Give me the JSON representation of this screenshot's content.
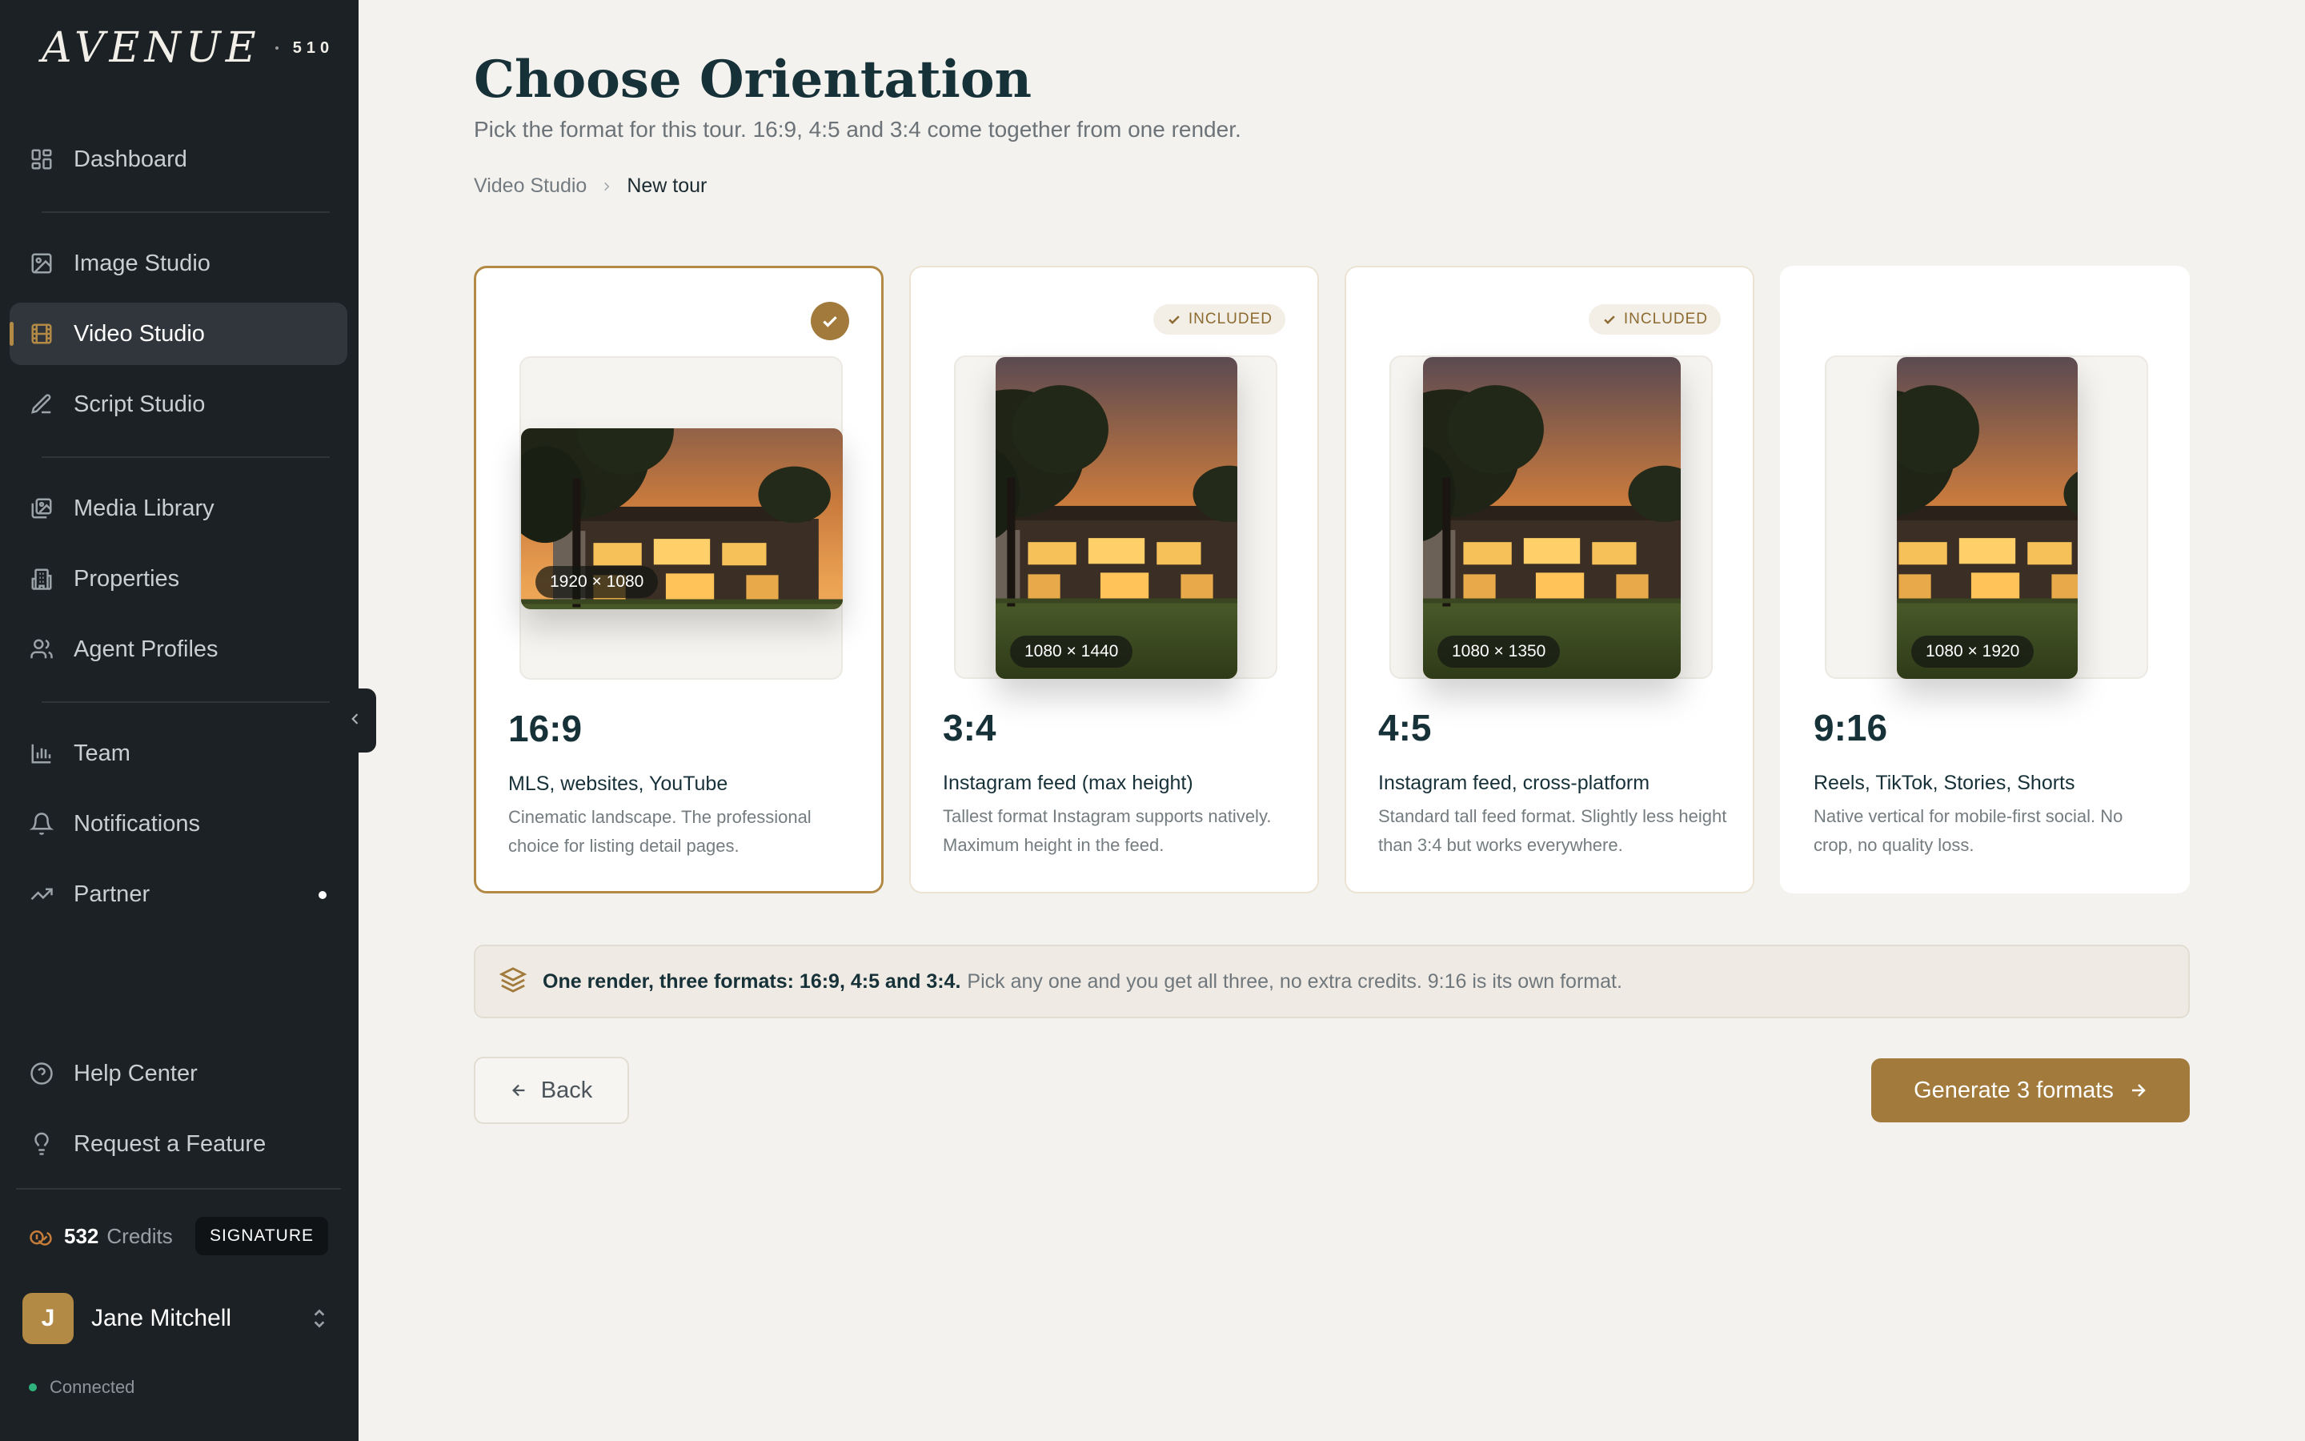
{
  "brand": {
    "name": "AVENUE",
    "number": "510"
  },
  "sidebar": {
    "items": [
      {
        "label": "Dashboard",
        "icon": "grid-icon"
      },
      {
        "label": "Image Studio",
        "icon": "image-icon"
      },
      {
        "label": "Video Studio",
        "icon": "film-icon",
        "active": true
      },
      {
        "label": "Script Studio",
        "icon": "pen-icon"
      },
      {
        "label": "Media Library",
        "icon": "media-library-icon"
      },
      {
        "label": "Properties",
        "icon": "building-icon"
      },
      {
        "label": "Agent Profiles",
        "icon": "users-icon"
      },
      {
        "label": "Team",
        "icon": "bar-chart-icon"
      },
      {
        "label": "Notifications",
        "icon": "bell-icon"
      },
      {
        "label": "Partner",
        "icon": "trending-up-icon"
      },
      {
        "label": "Help Center",
        "icon": "help-circle-icon"
      },
      {
        "label": "Request a Feature",
        "icon": "lightbulb-icon"
      }
    ],
    "credits": {
      "value": "532",
      "label": "Credits",
      "plan": "SIGNATURE"
    },
    "user": {
      "initial": "J",
      "name": "Jane Mitchell"
    },
    "status": "Connected"
  },
  "header": {
    "title": "Choose Orientation",
    "subtitle": "Pick the format for this tour. 16:9, 4:5 and 3:4 come together from one render.",
    "breadcrumb": [
      "Video Studio",
      "New tour"
    ]
  },
  "cards": [
    {
      "ratio": "16:9",
      "dims": "1920 × 1080",
      "title": "MLS, websites, YouTube",
      "desc": "Cinematic landscape. The professional choice for listing detail pages.",
      "state": "selected"
    },
    {
      "ratio": "3:4",
      "dims": "1080 × 1440",
      "title": "Instagram feed (max height)",
      "desc": "Tallest format Instagram supports natively. Maximum height in the feed.",
      "state": "included",
      "badge": "INCLUDED"
    },
    {
      "ratio": "4:5",
      "dims": "1080 × 1350",
      "title": "Instagram feed, cross-platform",
      "desc": "Standard tall feed format. Slightly less height than 3:4 but works everywhere.",
      "state": "included",
      "badge": "INCLUDED"
    },
    {
      "ratio": "9:16",
      "dims": "1080 × 1920",
      "title": "Reels, TikTok, Stories, Shorts",
      "desc": "Native vertical for mobile-first social. No crop, no quality loss.",
      "state": "none"
    }
  ],
  "info": {
    "strong": "One render, three formats: 16:9, 4:5 and 3:4.",
    "rest": "Pick any one and you get all three, no extra credits. 9:16 is its own format."
  },
  "actions": {
    "back": "Back",
    "generate": "Generate 3 formats"
  },
  "colors": {
    "accent": "#a27a3c",
    "sidebar": "#1c2125",
    "background": "#f4f2ee",
    "status": "#2fb37d"
  }
}
